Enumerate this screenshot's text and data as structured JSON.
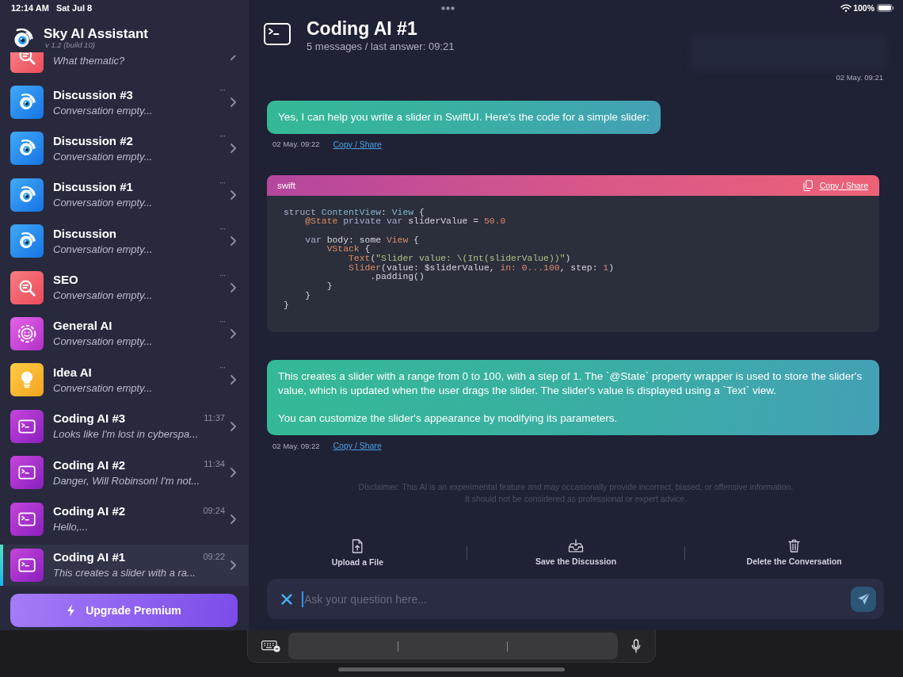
{
  "status_bar": {
    "time": "12:14 AM",
    "date": "Sat Jul 8",
    "battery": "100%"
  },
  "sidebar": {
    "app_name": "Sky AI Assistant",
    "version": "v 1.2 (build 10)",
    "partial_item": {
      "kind": "seo",
      "subtitle": "What thematic?"
    },
    "items": [
      {
        "kind": "eye",
        "title": "Discussion #3",
        "subtitle": "Conversation empty...",
        "trailing": {
          "kind": "more",
          "text": "···"
        },
        "selected": false
      },
      {
        "kind": "eye",
        "title": "Discussion #2",
        "subtitle": "Conversation empty...",
        "trailing": {
          "kind": "more",
          "text": "···"
        },
        "selected": false
      },
      {
        "kind": "eye",
        "title": "Discussion #1",
        "subtitle": "Conversation empty...",
        "trailing": {
          "kind": "more",
          "text": "···"
        },
        "selected": false
      },
      {
        "kind": "eye",
        "title": "Discussion",
        "subtitle": "Conversation empty...",
        "trailing": {
          "kind": "more",
          "text": "···"
        },
        "selected": false
      },
      {
        "kind": "seo",
        "title": "SEO",
        "subtitle": "Conversation empty...",
        "trailing": {
          "kind": "more",
          "text": "···"
        },
        "selected": false
      },
      {
        "kind": "smile",
        "title": "General AI",
        "subtitle": "Conversation empty...",
        "trailing": {
          "kind": "more",
          "text": "···"
        },
        "selected": false
      },
      {
        "kind": "bulb",
        "title": "Idea AI",
        "subtitle": "Conversation empty...",
        "trailing": {
          "kind": "more",
          "text": "···"
        },
        "selected": false
      },
      {
        "kind": "terminal",
        "title": "Coding AI #3",
        "subtitle": "Looks like I'm lost in cyberspa...",
        "trailing": {
          "kind": "time",
          "text": "11:37"
        },
        "selected": false
      },
      {
        "kind": "terminal",
        "title": "Coding AI #2",
        "subtitle": "Danger, Will Robinson! I'm not...",
        "trailing": {
          "kind": "time",
          "text": "11:34"
        },
        "selected": false
      },
      {
        "kind": "terminal",
        "title": "Coding AI #2",
        "subtitle": "Hello,...",
        "trailing": {
          "kind": "time",
          "text": "09:24"
        },
        "selected": false
      },
      {
        "kind": "terminal",
        "title": "Coding AI #1",
        "subtitle": "This creates a slider with a ra...",
        "trailing": {
          "kind": "time",
          "text": "09:22"
        },
        "selected": true
      }
    ],
    "upgrade_button": "Upgrade Premium"
  },
  "chat": {
    "title": "Coding AI #1",
    "subtitle": "5 messages / last answer: 09:21",
    "messages": [
      {
        "kind": "blurred",
        "time": "02 May. 09:21"
      },
      {
        "kind": "text",
        "paragraphs": [
          "Yes, I can help you write a slider in SwiftUI. Here's the code for a simple slider:"
        ],
        "time": "02 May. 09:22",
        "link": "Copy / Share"
      },
      {
        "kind": "code",
        "language": "swift",
        "link": "Copy / Share",
        "blocks": [
          [
            [
              {
                "text": "struct ",
                "kind": "keyword"
              },
              {
                "text": "ContentView",
                "kind": "type"
              },
              {
                "text": ": ",
                "kind": "plain"
              },
              {
                "text": "View",
                "kind": "type"
              },
              {
                "text": " {",
                "kind": "plain"
              }
            ],
            [
              {
                "text": "    @State",
                "kind": "symbol"
              },
              {
                "text": " private var",
                "kind": "keyword"
              },
              {
                "text": " sliderValue = ",
                "kind": "plain"
              },
              {
                "text": "50.0",
                "kind": "number"
              }
            ]
          ],
          [
            [
              {
                "text": "    var",
                "kind": "keyword"
              },
              {
                "text": " body: some ",
                "kind": "plain"
              },
              {
                "text": "View",
                "kind": "symbol"
              },
              {
                "text": " {",
                "kind": "plain"
              }
            ],
            [
              {
                "text": "        VStack",
                "kind": "symbol"
              },
              {
                "text": " {",
                "kind": "plain"
              }
            ],
            [
              {
                "text": "            Text",
                "kind": "symbol"
              },
              {
                "text": "(",
                "kind": "plain"
              },
              {
                "text": "\"Slider value: \\(Int(sliderValue))\"",
                "kind": "string"
              },
              {
                "text": ")",
                "kind": "plain"
              }
            ],
            [
              {
                "text": "            Slider",
                "kind": "symbol"
              },
              {
                "text": "(value: $sliderValue, ",
                "kind": "plain"
              },
              {
                "text": "in: 0...100",
                "kind": "symbol"
              },
              {
                "text": ", step: ",
                "kind": "plain"
              },
              {
                "text": "1",
                "kind": "number"
              },
              {
                "text": ")",
                "kind": "plain"
              }
            ],
            [
              {
                "text": "                .padding()",
                "kind": "plain"
              }
            ],
            [
              {
                "text": "        }",
                "kind": "plain"
              }
            ],
            [
              {
                "text": "    }",
                "kind": "plain"
              }
            ],
            [
              {
                "text": "}",
                "kind": "plain"
              }
            ]
          ]
        ]
      },
      {
        "kind": "text",
        "paragraphs": [
          "This creates a slider with a range from 0 to 100, with a step of 1. The `@State` property wrapper is used to store the slider's value, which is updated when the user drags the slider. The slider's value is displayed using a `Text` view.",
          "You can customize the slider's appearance by modifying its parameters."
        ],
        "time": "02 May. 09:22",
        "link": "Copy / Share"
      }
    ],
    "disclaimer": [
      "Disclaimer: This AI is an experimental feature and may occasionally provide incorrect, biased, or offensive information.",
      "It should not be considered as professional or expert advice."
    ],
    "actions": [
      {
        "kind": "upload",
        "label": "Upload a File"
      },
      {
        "kind": "save",
        "label": "Save the Discussion"
      },
      {
        "kind": "delete",
        "label": "Delete the Conversation"
      }
    ],
    "input": {
      "placeholder": "Ask your question here..."
    }
  }
}
